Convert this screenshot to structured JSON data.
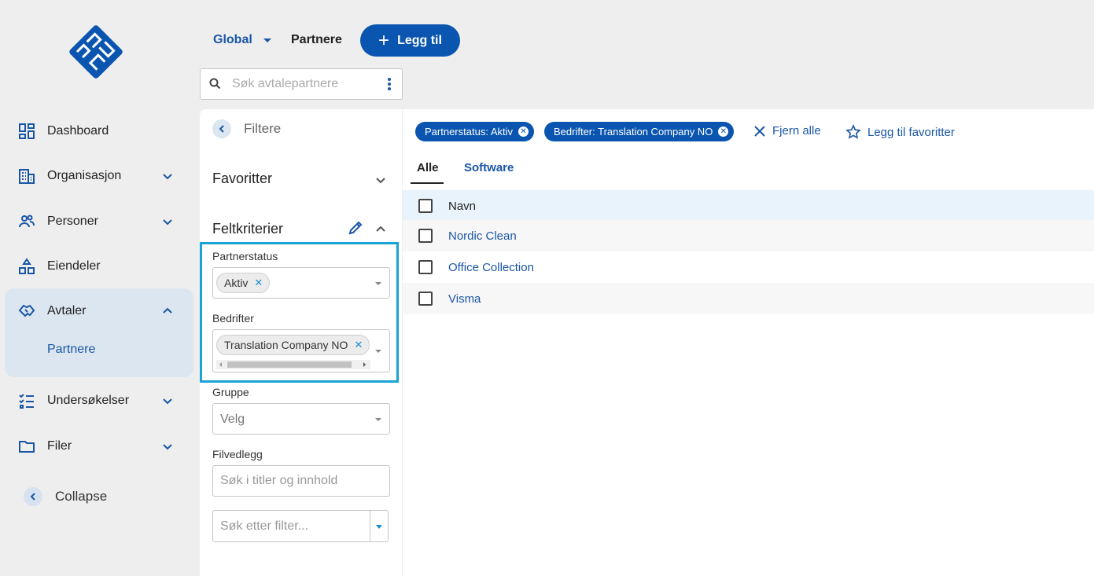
{
  "topbar": {
    "scope_label": "Global",
    "breadcrumb": "Partnere",
    "add_button_label": "Legg til",
    "search_placeholder": "Søk avtalepartnere"
  },
  "sidebar": {
    "items": [
      {
        "label": "Dashboard",
        "icon": "dashboard-icon"
      },
      {
        "label": "Organisasjon",
        "icon": "building-icon"
      },
      {
        "label": "Personer",
        "icon": "people-icon"
      },
      {
        "label": "Eiendeler",
        "icon": "assets-icon"
      },
      {
        "label": "Avtaler",
        "icon": "handshake-icon"
      },
      {
        "label": "Undersøkelser",
        "icon": "checklist-icon"
      },
      {
        "label": "Filer",
        "icon": "folder-icon"
      }
    ],
    "sub_item": "Partnere",
    "collapse_label": "Collapse"
  },
  "filters": {
    "title": "Filtere",
    "favorites_title": "Favoritter",
    "criteria_title": "Feltkriterier",
    "partnerstatus_label": "Partnerstatus",
    "partnerstatus_value": "Aktiv",
    "bedrifter_label": "Bedrifter",
    "bedrifter_value": "Translation Company NO",
    "gruppe_label": "Gruppe",
    "gruppe_placeholder": "Velg",
    "filvedlegg_label": "Filvedlegg",
    "filvedlegg_placeholder": "Søk i titler og innhold",
    "search_filter_placeholder": "Søk etter filter..."
  },
  "active_filters": {
    "chips": [
      "Partnerstatus: Aktiv",
      "Bedrifter: Translation Company NO"
    ],
    "clear_all": "Fjern alle",
    "add_favorite": "Legg til favoritter"
  },
  "tabs": [
    "Alle",
    "Software"
  ],
  "table": {
    "header": "Navn",
    "rows": [
      "Nordic Clean",
      "Office Collection",
      "Visma"
    ]
  },
  "colors": {
    "primary": "#0a55b0",
    "link": "#1a56a6",
    "highlight_border": "#1aa3d6",
    "header_row_bg": "#e8f3fc",
    "sidebar_active_bg": "#dce6f0"
  }
}
